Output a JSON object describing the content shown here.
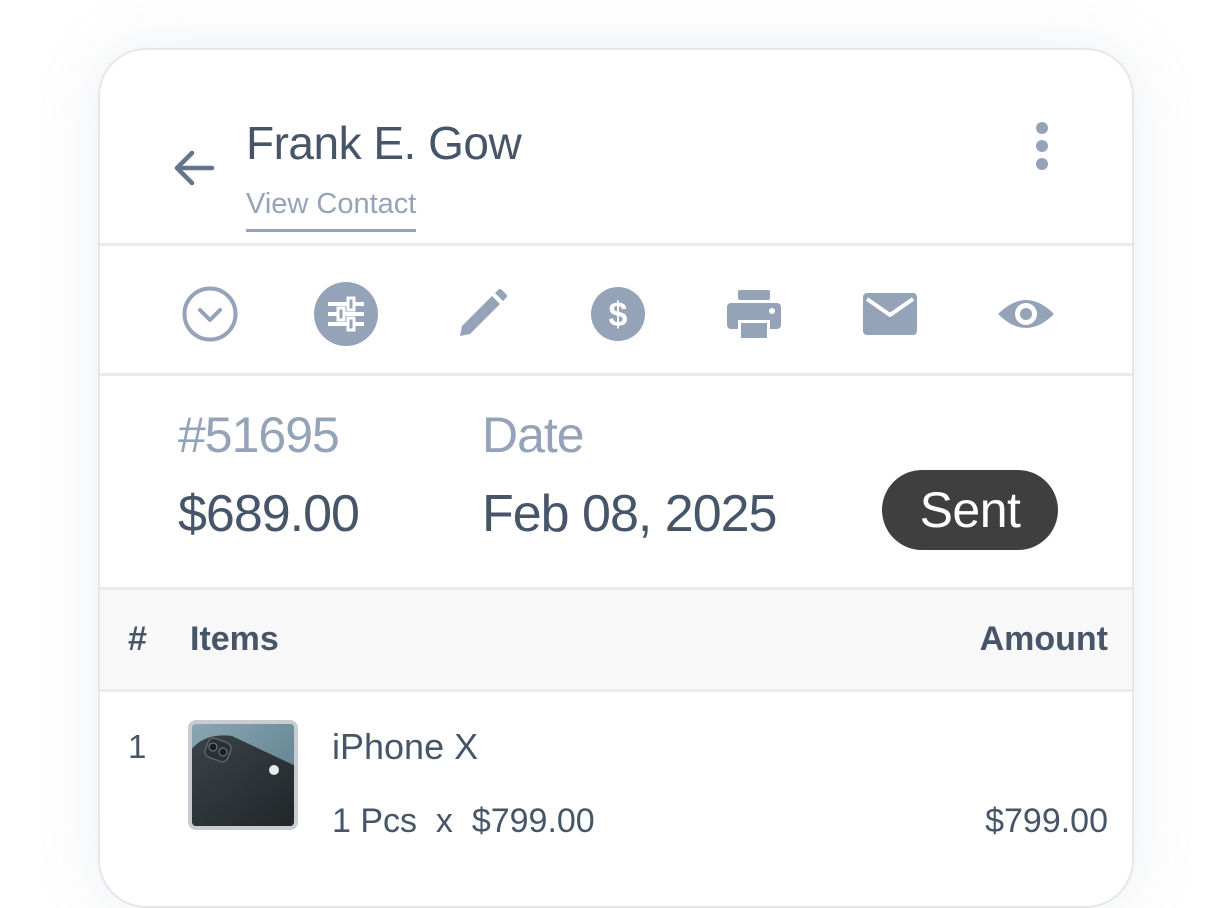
{
  "header": {
    "contact_name": "Frank E. Gow",
    "view_contact_label": "View Contact"
  },
  "toolbar": {
    "icons": [
      "chevron-down-circle-icon",
      "sliders-icon",
      "pencil-icon",
      "dollar-icon",
      "printer-icon",
      "mail-icon",
      "eye-icon"
    ],
    "icon_color": "#94a3b8"
  },
  "summary": {
    "invoice_number": "#51695",
    "amount": "$689.00",
    "date_label": "Date",
    "date_value": "Feb 08, 2025",
    "status": "Sent",
    "status_color": "#3f3f3f"
  },
  "table": {
    "headers": {
      "num": "#",
      "items": "Items",
      "amount": "Amount"
    },
    "rows": [
      {
        "num": "1",
        "name": "iPhone X",
        "qty": "1 Pcs  x  $799.00",
        "amount": "$799.00"
      }
    ]
  }
}
